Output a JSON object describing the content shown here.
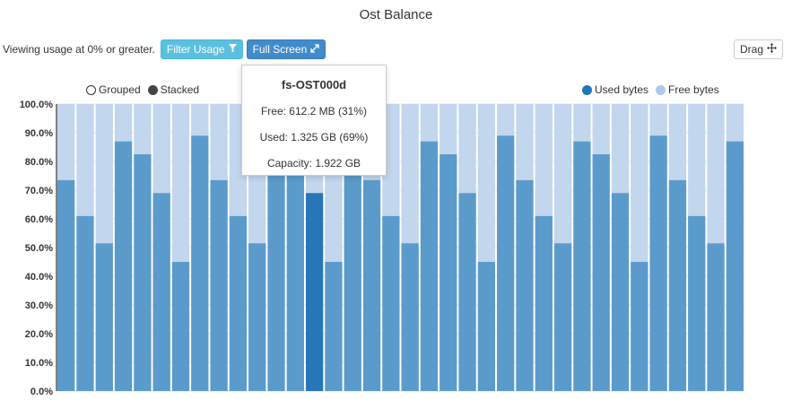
{
  "title": "Ost Balance",
  "toolbar": {
    "viewing_text": "Viewing usage at 0% or greater.",
    "filter_label": "Filter Usage",
    "fullscreen_label": "Full Screen",
    "drag_label": "Drag"
  },
  "legend_left": {
    "grouped_label": "Grouped",
    "stacked_label": "Stacked"
  },
  "legend_right": {
    "used_label": "Used bytes",
    "free_label": "Free bytes"
  },
  "tooltip": {
    "title": "fs-OST000d",
    "free": "Free: 612.2 MB (31%)",
    "used": "Used: 1.325 GB (69%)",
    "capacity": "Capacity: 1.922 GB"
  },
  "colors": {
    "used": "#5b9bcc",
    "used_highlight": "#2777b8",
    "free": "#c2d6ee",
    "filter_button": "#5bc0de",
    "fullscreen_button": "#428bca"
  },
  "icons": {
    "filter": "filter-icon",
    "fullscreen": "expand-arrows-icon",
    "drag": "move-icon"
  },
  "chart_data": {
    "type": "bar",
    "stacked": true,
    "ylim": [
      0,
      100
    ],
    "y_ticks": [
      "0.0%",
      "10.0%",
      "20.0%",
      "30.0%",
      "40.0%",
      "50.0%",
      "60.0%",
      "70.0%",
      "80.0%",
      "90.0%",
      "100.0%"
    ],
    "highlighted_index": 13,
    "series": [
      {
        "name": "Used bytes",
        "values": [
          73.5,
          61,
          51.5,
          87,
          82.5,
          69,
          45,
          89,
          73.5,
          61,
          51.5,
          87,
          82.5,
          69,
          45,
          89,
          73.5,
          61,
          51.5,
          87,
          82.5,
          69,
          45,
          89,
          73.5,
          61,
          51.5,
          87,
          82.5,
          69,
          45,
          89,
          73.5,
          61,
          51.5,
          87
        ]
      },
      {
        "name": "Free bytes",
        "values": [
          26.5,
          39,
          48.5,
          13,
          17.5,
          31,
          55,
          11,
          26.5,
          39,
          48.5,
          13,
          17.5,
          31,
          55,
          11,
          26.5,
          39,
          48.5,
          13,
          17.5,
          31,
          55,
          11,
          26.5,
          39,
          48.5,
          13,
          17.5,
          31,
          55,
          11,
          26.5,
          39,
          48.5,
          13
        ]
      }
    ]
  }
}
